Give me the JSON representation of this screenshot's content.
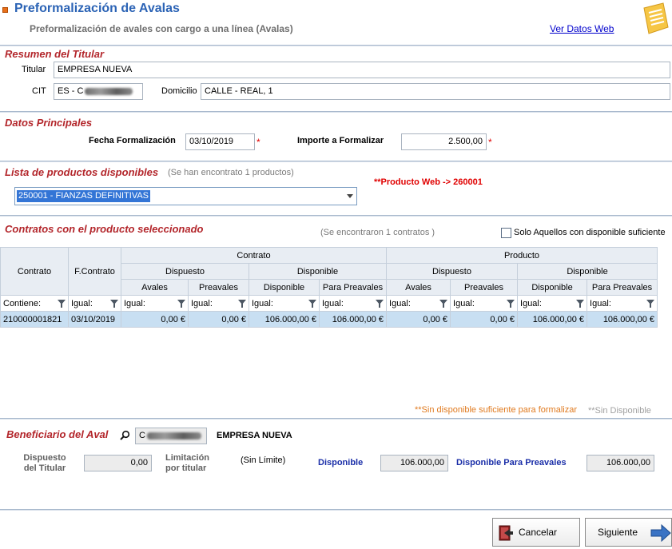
{
  "header": {
    "title": "Preformalización de Avalas",
    "subtitle": "Preformalización de avales con cargo a una línea (Avalas)",
    "web_link": "Ver Datos Web"
  },
  "resumen": {
    "section_title": "Resumen del Titular",
    "titular_label": "Titular",
    "titular_value": "EMPRESA NUEVA",
    "cit_label": "CIT",
    "cit_value": "ES - C",
    "domicilio_label": "Domicilio",
    "domicilio_value": "CALLE - REAL, 1"
  },
  "datos": {
    "section_title": "Datos Principales",
    "fecha_label": "Fecha Formalización",
    "fecha_value": "03/10/2019",
    "importe_label": "Importe a Formalizar",
    "importe_value": "2.500,00",
    "required_mark": "*"
  },
  "productos": {
    "section_title": "Lista de productos disponibles",
    "count_text": "(Se han encontrato 1 productos)",
    "selected": "250001 - FIANZAS DEFINITIVAS",
    "web_note": "**Producto Web -> 260001"
  },
  "contratos": {
    "section_title": "Contratos con el producto seleccionado",
    "count_text": "(Se encontraron 1 contratos )",
    "checkbox_label": "Solo Aquellos con disponible suficiente",
    "checkbox_checked": false,
    "headers": {
      "contrato": "Contrato",
      "fcontrato": "F.Contrato",
      "group_contrato": "Contrato",
      "group_producto": "Producto",
      "dispuesto": "Dispuesto",
      "disponible": "Disponible",
      "avales": "Avales",
      "preavales": "Preavales",
      "disponible_col": "Disponible",
      "para_preavales": "Para Preavales"
    },
    "filters": [
      "Contiene:",
      "Igual:",
      "Igual:",
      "Igual:",
      "Igual:",
      "Igual:",
      "Igual:",
      "Igual:",
      "Igual:",
      "Igual:"
    ],
    "rows": [
      [
        "210000001821",
        "03/10/2019",
        "0,00 €",
        "0,00 €",
        "106.000,00 €",
        "106.000,00 €",
        "0,00 €",
        "0,00 €",
        "106.000,00 €",
        "106.000,00 €"
      ]
    ],
    "note_orange": "**Sin disponible suficiente para formalizar",
    "note_gray": "**Sin Disponible"
  },
  "beneficiario": {
    "section_title": "Beneficiario del Aval",
    "cif_value": "C",
    "name": "EMPRESA NUEVA",
    "dispuesto_label_1": "Dispuesto",
    "dispuesto_label_2": "del Titular",
    "dispuesto_value": "0,00",
    "limitacion_label_1": "Limitación",
    "limitacion_label_2": "por titular",
    "limitacion_value": "(Sin Límite)",
    "disponible_label": "Disponible",
    "disponible_value": "106.000,00",
    "disponible_pre_label": "Disponible Para Preavales",
    "disponible_pre_value": "106.000,00"
  },
  "buttons": {
    "cancel": "Cancelar",
    "next": "Siguiente"
  },
  "colors": {
    "title_blue": "#2b63b5",
    "section_red": "#b3262b",
    "required_red": "#e00000",
    "row_selected": "#c8dff2",
    "label_blue": "#1a2ea8"
  }
}
